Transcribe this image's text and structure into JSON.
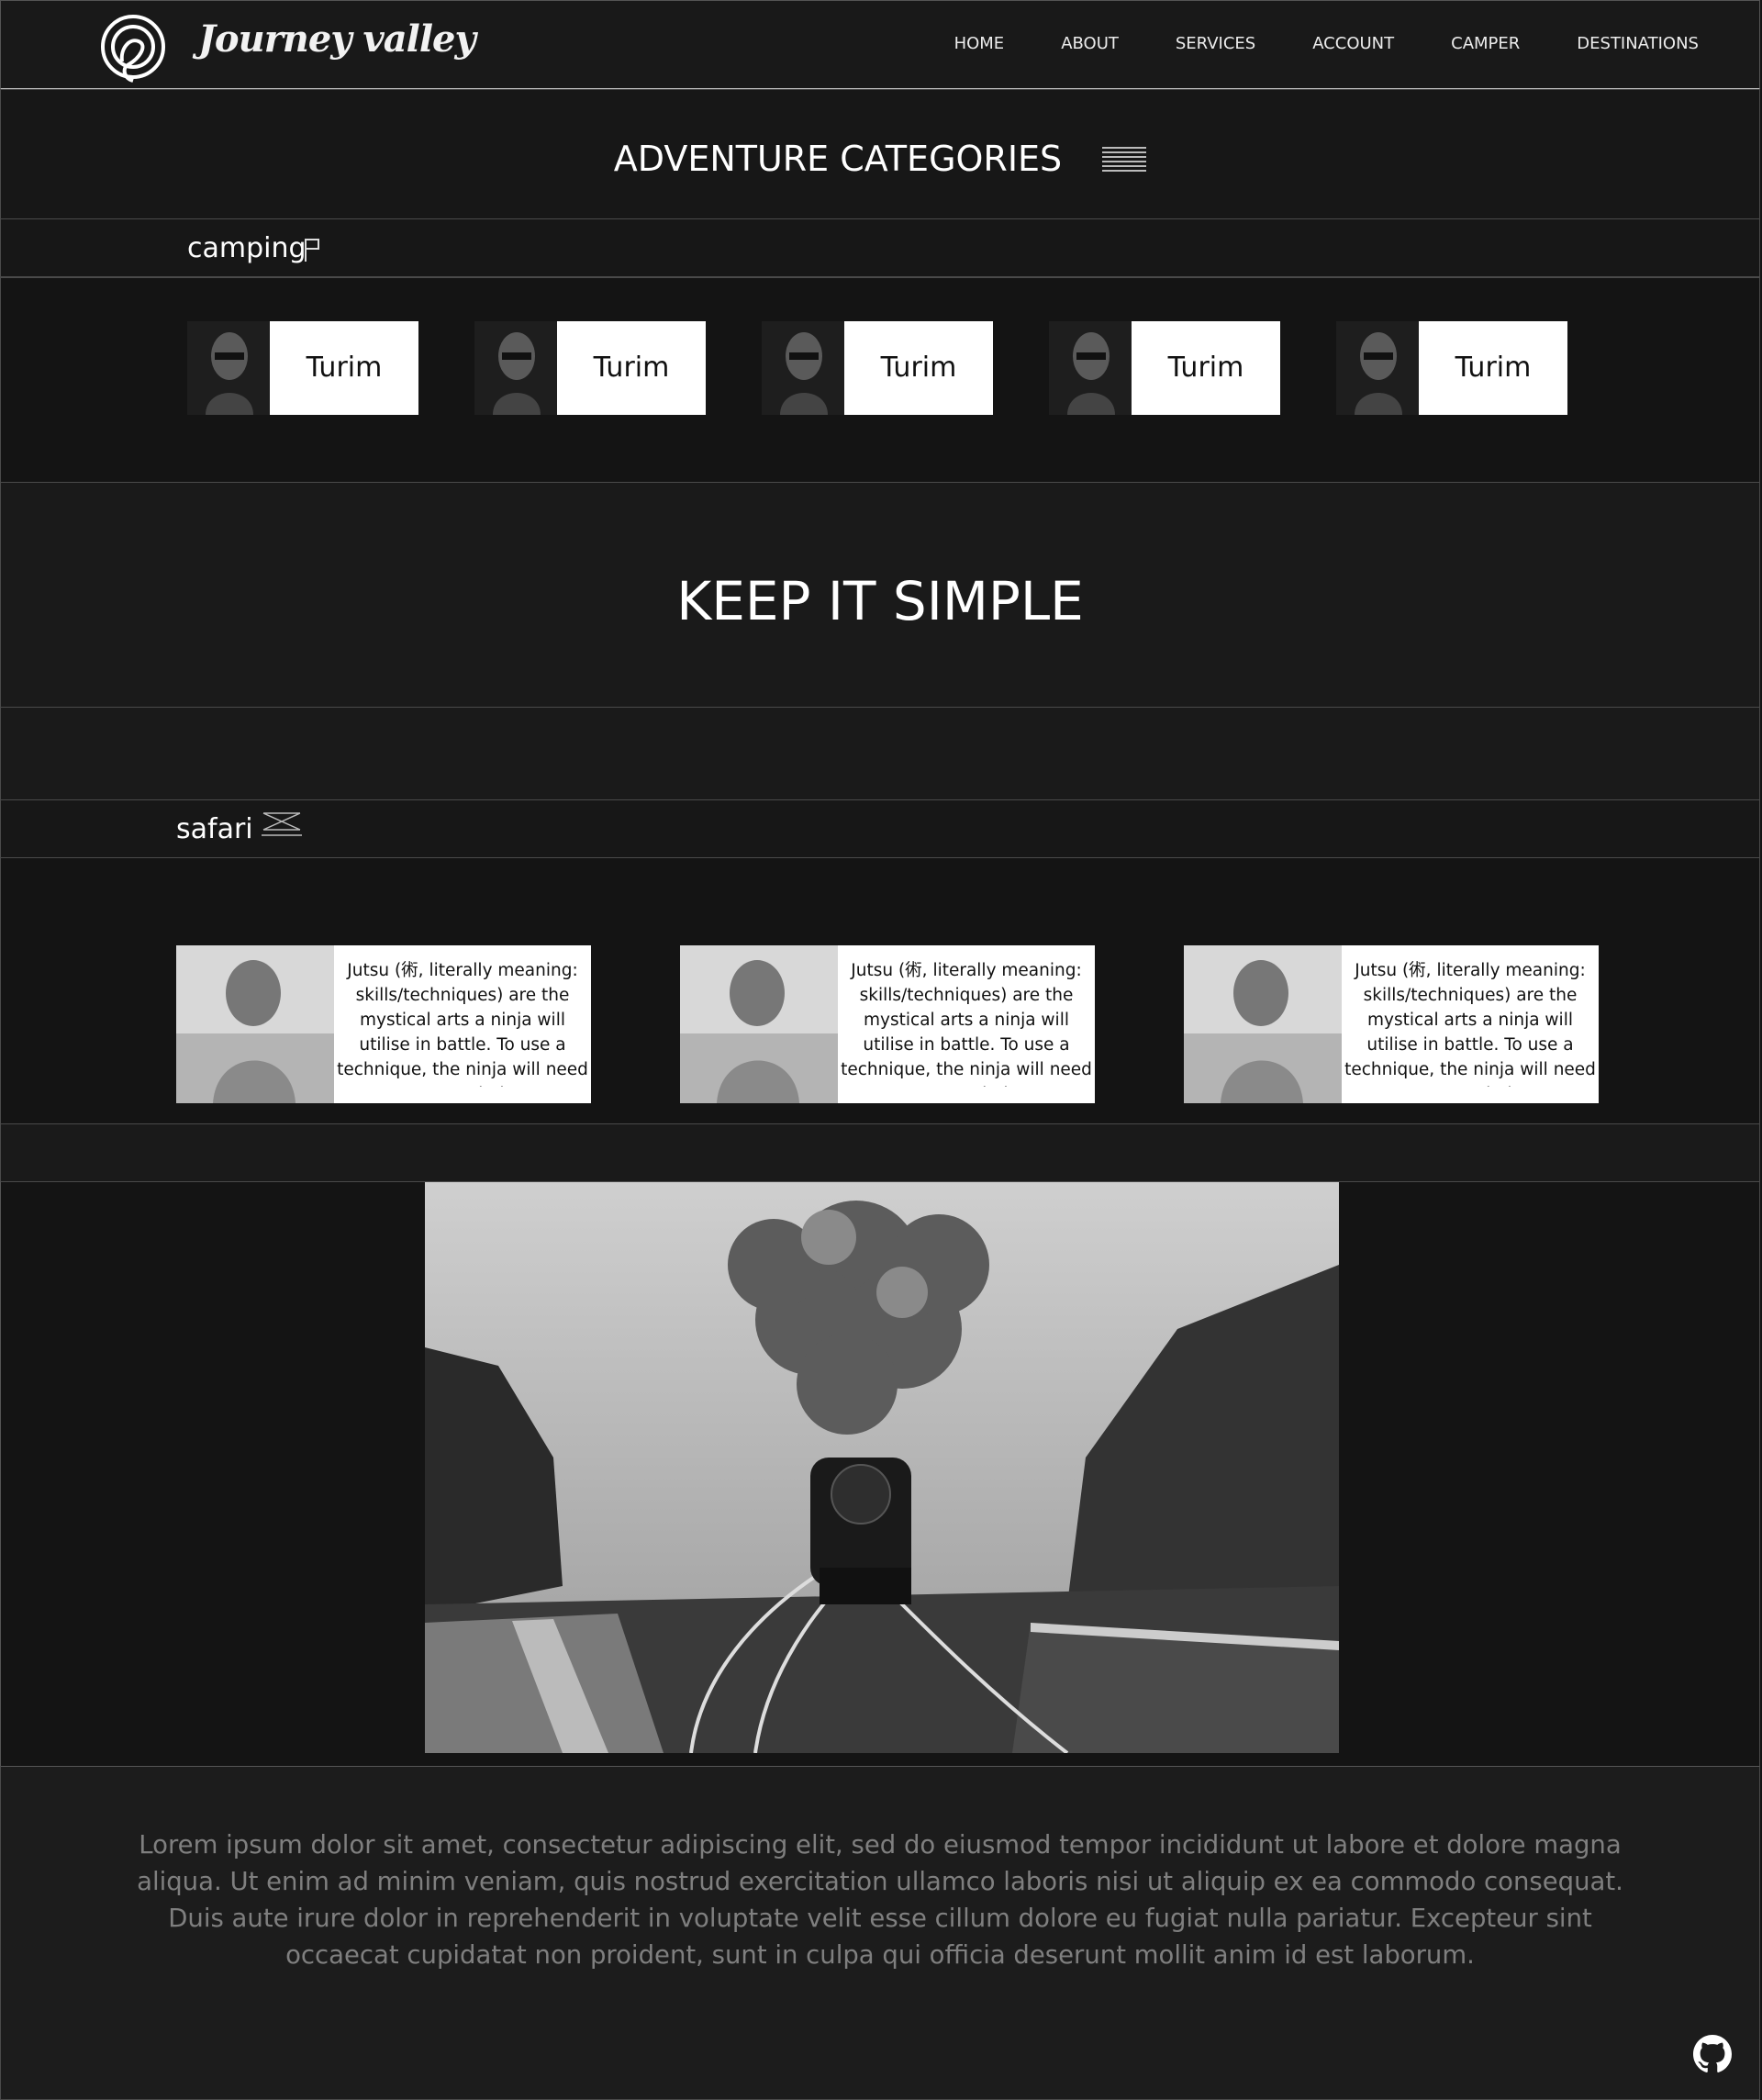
{
  "brand": {
    "name": "Journey valley",
    "logo_icon": "spiral-logo-icon"
  },
  "nav": {
    "items": [
      "HOME",
      "ABOUT",
      "SERVICES",
      "ACCOUNT",
      "CAMPER",
      "DESTINATIONS"
    ]
  },
  "categories": {
    "title": "ADVENTURE CATEGORIES",
    "menu_icon": "hamburger-lines-icon"
  },
  "camping": {
    "label": "camping",
    "icon": "flag-icon",
    "cards": [
      {
        "name": "Turim"
      },
      {
        "name": "Turim"
      },
      {
        "name": "Turim"
      },
      {
        "name": "Turim"
      },
      {
        "name": "Turim"
      }
    ]
  },
  "keep": {
    "title": "KEEP IT SIMPLE"
  },
  "safari": {
    "label": "safari",
    "icon": "scribble-icon",
    "cards": [
      {
        "text": "Jutsu (術, literally meaning: skills/techniques) are the mystical arts a ninja will utilise in battle. To use a technique, the ninja will need to use their"
      },
      {
        "text": "Jutsu (術, literally meaning: skills/techniques) are the mystical arts a ninja will utilise in battle. To use a technique, the ninja will need to use their"
      },
      {
        "text": "Jutsu (術, literally meaning: skills/techniques) are the mystical arts a ninja will utilise in battle. To use a technique, the ninja will need to use their"
      }
    ]
  },
  "feature_image": {
    "label": "steam-train-photo"
  },
  "footer": {
    "text": "Lorem ipsum dolor sit amet, consectetur adipiscing elit, sed do eiusmod tempor incididunt ut labore et dolore magna aliqua. Ut enim ad minim veniam, quis nostrud exercitation ullamco laboris nisi ut aliquip ex ea commodo consequat. Duis aute irure dolor in reprehenderit in voluptate velit esse cillum dolore eu fugiat nulla pariatur. Excepteur sint occaecat cupidatat non proident, sunt in culpa qui officia deserunt mollit anim id est laborum.",
    "github_icon": "github-icon"
  },
  "colors": {
    "background": "#141414",
    "panel": "#1a1a1a",
    "text": "#ffffff",
    "muted_text": "#7f7f7f"
  }
}
